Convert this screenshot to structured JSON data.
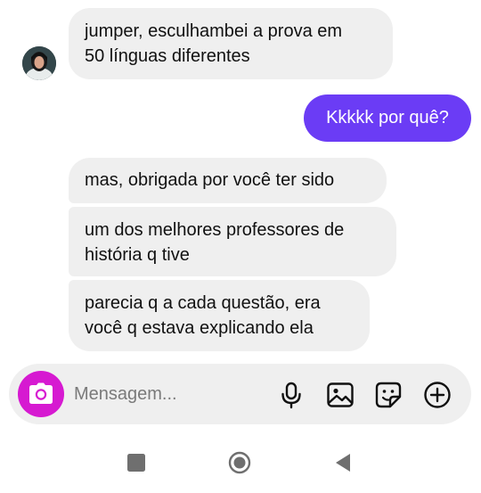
{
  "messages": {
    "incoming_1": {
      "line1": "jumper, esculhambei a prova em",
      "line2": "50 línguas diferentes"
    },
    "outgoing_1": {
      "text": "Kkkkk por quê?"
    },
    "incoming_2": {
      "line1": "mas, obrigada por você ter sido"
    },
    "incoming_3": {
      "line1": "um dos melhores professores de",
      "line2": "história q tive"
    },
    "incoming_4": {
      "line1": "parecia q a cada questão, era",
      "line2": "você q estava explicando ela"
    }
  },
  "composer": {
    "placeholder": "Mensagem...",
    "icons": [
      "camera-icon",
      "microphone-icon",
      "gallery-icon",
      "sticker-icon",
      "add-icon"
    ]
  },
  "navigation": {
    "icons": [
      "recent-apps-icon",
      "home-icon",
      "back-icon"
    ]
  },
  "colors": {
    "outgoing_bubble": "#6b3cf5",
    "incoming_bubble": "#efefef",
    "camera_button": "#d61ad1",
    "composer_bg": "#efefef"
  }
}
